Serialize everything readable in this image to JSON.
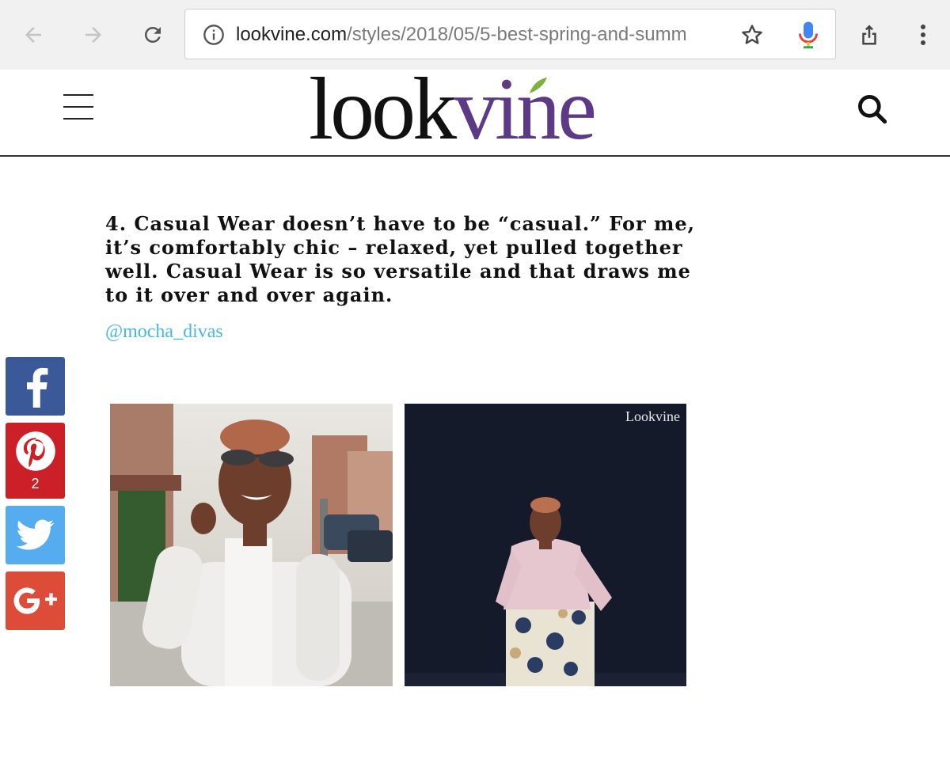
{
  "browser": {
    "url_host": "lookvine.com",
    "url_path": "/styles/2018/05/5-best-spring-and-summ",
    "back_icon": "arrow-left-icon",
    "forward_icon": "arrow-right-icon",
    "reload_icon": "reload-icon",
    "info_icon": "info-icon",
    "bookmark_icon": "star-icon",
    "voice_icon": "microphone-icon",
    "share_icon": "share-icon",
    "menu_icon": "more-vert-icon"
  },
  "site": {
    "logo_look": "look",
    "logo_vine": "vine",
    "brand_color": "#5d3a86",
    "menu_icon": "hamburger-icon",
    "search_icon": "search-icon"
  },
  "article": {
    "caption": "4. Casual Wear doesn’t have to be “casual.” For me, it’s comfortably chic – relaxed, yet pulled together well. Casual Wear is so versatile and that draws me to it over and over again.",
    "handle": "@mocha_divas",
    "handle_color": "#47b7e3"
  },
  "share": {
    "facebook_icon": "facebook-icon",
    "pinterest_icon": "pinterest-icon",
    "pinterest_count": "2",
    "twitter_icon": "twitter-icon",
    "googleplus_icon": "google-plus-icon",
    "colors": {
      "facebook": "#3b5998",
      "pinterest": "#cb2027",
      "twitter": "#55acee",
      "googleplus": "#dd4b39"
    }
  },
  "photos": {
    "left_watermark": "",
    "right_watermark": "Lookvine"
  }
}
